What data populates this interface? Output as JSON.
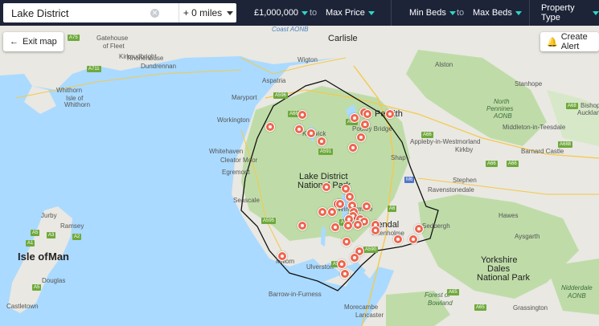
{
  "search": {
    "value": "Lake District",
    "radius": "+ 0 miles"
  },
  "filters": {
    "min_price": "£1,000,000",
    "to1": "to",
    "max_price": "Max Price",
    "min_beds": "Min Beds",
    "to2": "to",
    "max_beds": "Max Beds",
    "property_type": "Property Type"
  },
  "buttons": {
    "exit_map": "Exit map",
    "create_alert": "Create Alert"
  },
  "map_labels": {
    "coast_aonb": "Coast AONB",
    "carlisle": "Carlisle",
    "gatehouse": "Gatehouse",
    "of_fleet": "of Fleet",
    "kirkcudbright": "Kirkcudbright",
    "rhonehouse": "Rhonehouse",
    "dundrennan": "Dundrennan",
    "wigton": "Wigton",
    "whithorn": "Whithorn",
    "isle_of": "Isle of",
    "whithorn2": "Whithorn",
    "aspatria": "Aspatria",
    "maryport": "Maryport",
    "alston": "Alston",
    "stanhope": "Stanhope",
    "north_pennines": "North",
    "pennines2": "Pennines",
    "aonb": "AONB",
    "workington": "Workington",
    "penrith": "Penrith",
    "pooley_bridge": "Pooley Bridge",
    "keswick": "Keswick",
    "middleton": "Middleton-in-Teesdale",
    "bishop": "Bishop",
    "auckland": "Auckland",
    "appleby": "Appleby-in-Westmorland",
    "whitehaven": "Whitehaven",
    "cleator_moor": "Cleator Moor",
    "egremont": "Egremont",
    "barnard_castle": "Barnard Castle",
    "shap": "Shap",
    "ld_np1": "Lake District",
    "ld_np2": "National Park",
    "kirkby": "Kirkby",
    "stephen": "Stephen",
    "ravenstonedale": "Ravenstonedale",
    "seascale": "Seascale",
    "jurby": "Jurby",
    "ramsey": "Ramsey",
    "windermere": "Windermere",
    "kendal": "Kendal",
    "oxenholme": "Oxenholme",
    "sedbergh": "Sedbergh",
    "hawes": "Hawes",
    "aysgarth": "Aysgarth",
    "isle_of_man1": "Isle of",
    "isle_of_man2": "Man",
    "millom": "Millom",
    "ulverston": "Ulverston",
    "yorkshire_dales1": "Yorkshire",
    "yorkshire_dales2": "Dales",
    "yorkshire_dales3": "National Park",
    "nidderdale1": "Nidderdale",
    "nidderdale2": "AONB",
    "douglas": "Douglas",
    "castletown": "Castletown",
    "barrow": "Barrow-in-Furness",
    "morecambe": "Morecambe",
    "lancaster": "Lancaster",
    "forest_of": "Forest of",
    "bowland": "Bowland",
    "grassington": "Grassington"
  },
  "road_labels": [
    "A75",
    "A711",
    "A596",
    "A595",
    "A66",
    "A66",
    "A591",
    "A6",
    "A592",
    "A590",
    "A595",
    "A5",
    "A3",
    "A2",
    "A1",
    "A5",
    "M6",
    "A65",
    "A66",
    "A66",
    "A688",
    "A68",
    "A65",
    "A66"
  ],
  "colors": {
    "topbar": "#1d2438",
    "accent": "#2bd9c6",
    "marker": "#f0654d",
    "land": "#e8e8e1",
    "national_park": "#b7d8a0",
    "sea": "#aadaff"
  }
}
